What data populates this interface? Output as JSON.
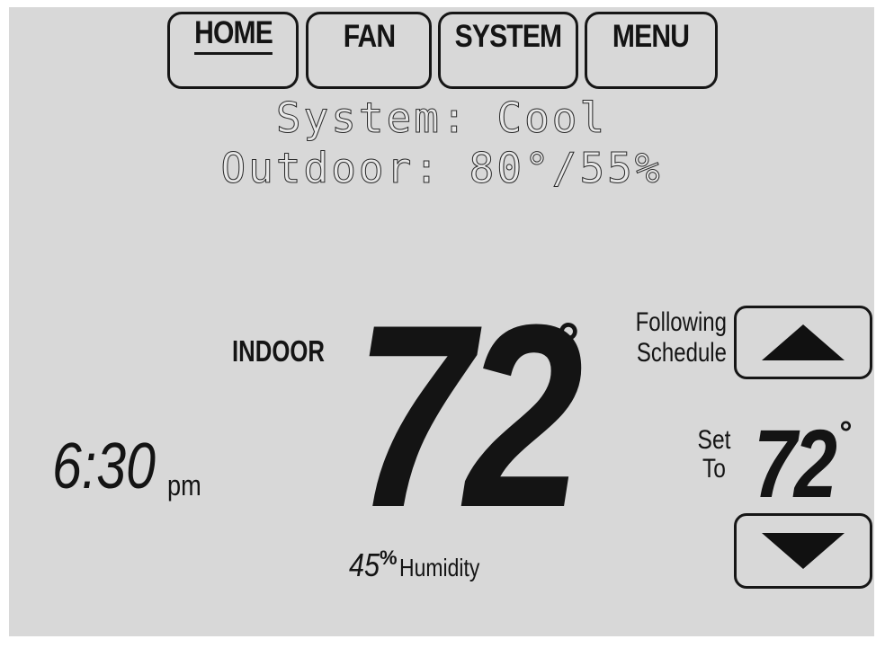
{
  "topnav": {
    "home_label": "HOME",
    "fan_label": "FAN",
    "system_label": "SYSTEM",
    "menu_label": "MENU"
  },
  "status": {
    "system_line": "System: Cool",
    "outdoor_line": "Outdoor: 80°/55%"
  },
  "indoor": {
    "label": "INDOOR",
    "temperature": "72",
    "degree_symbol": "°",
    "humidity_value": "45",
    "humidity_unit": "%",
    "humidity_label": "Humidity"
  },
  "clock": {
    "time": "6:30",
    "period": "pm"
  },
  "schedule": {
    "line1": "Following",
    "line2": "Schedule"
  },
  "setpoint": {
    "label_line1": "Set",
    "label_line2": "To",
    "temperature": "72",
    "degree_symbol": "°"
  },
  "icons": {
    "up": "up-triangle-icon",
    "down": "down-triangle-icon"
  },
  "colors": {
    "screen_bg": "#d8d8d8",
    "ink": "#141414"
  }
}
